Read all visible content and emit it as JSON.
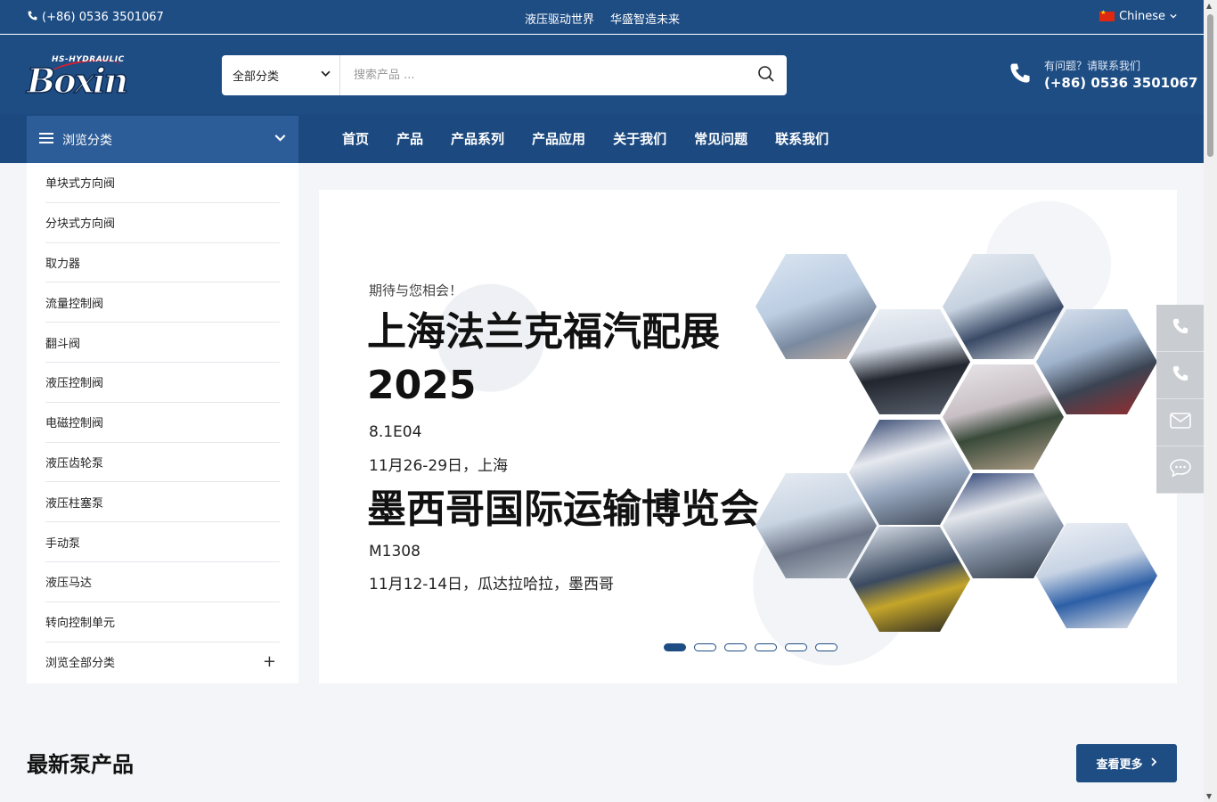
{
  "topbar": {
    "phone": "(+86) 0536 3501067",
    "slogan_1": "液压驱动世界",
    "slogan_2": "华盛智造未来",
    "language": "Chinese"
  },
  "header": {
    "logo_text": "Boxin",
    "logo_sub": "HS-HYDRAULIC",
    "search_category": "全部分类",
    "search_placeholder": "搜索产品 ...",
    "contact_question": "有问题？请联系我们",
    "contact_phone": "(+86) 0536 3501067"
  },
  "nav": {
    "browse_label": "浏览分类",
    "items": [
      "首页",
      "产品",
      "产品系列",
      "产品应用",
      "关于我们",
      "常见问题",
      "联系我们"
    ]
  },
  "sidebar": {
    "items": [
      "单块式方向阀",
      "分块式方向阀",
      "取力器",
      "流量控制阀",
      "翻斗阀",
      "液压控制阀",
      "电磁控制阀",
      "液压齿轮泵",
      "液压柱塞泵",
      "手动泵",
      "液压马达",
      "转向控制单元",
      "浏览全部分类"
    ]
  },
  "banner": {
    "subtitle": "期待与您相会！",
    "title_1": "上海法兰克福汽配展 2025",
    "booth_1": "8.1E04",
    "date_1": "11月26-29日，上海",
    "title_2": "墨西哥国际运输博览会",
    "booth_2": "M1308",
    "date_2": "11月12-14日，瓜达拉哈拉，墨西哥",
    "slide_count": 6,
    "active_slide": 1
  },
  "section": {
    "title": "最新泵产品",
    "more_label": "查看更多"
  },
  "colors": {
    "primary": "#1e4d84",
    "nav": "#1c4a80",
    "browse": "#2d5d98"
  }
}
